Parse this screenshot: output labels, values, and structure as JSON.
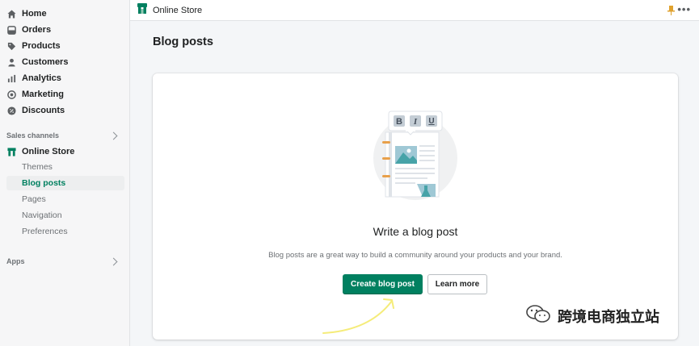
{
  "sidebar": {
    "items": [
      {
        "label": "Home",
        "icon": "home-icon"
      },
      {
        "label": "Orders",
        "icon": "orders-icon"
      },
      {
        "label": "Products",
        "icon": "tag-icon"
      },
      {
        "label": "Customers",
        "icon": "person-icon"
      },
      {
        "label": "Analytics",
        "icon": "bar-chart-icon"
      },
      {
        "label": "Marketing",
        "icon": "target-icon"
      },
      {
        "label": "Discounts",
        "icon": "discount-icon"
      }
    ],
    "sales_channels_label": "Sales channels",
    "online_store_label": "Online Store",
    "sub_items": [
      {
        "label": "Themes"
      },
      {
        "label": "Blog posts",
        "active": true
      },
      {
        "label": "Pages"
      },
      {
        "label": "Navigation"
      },
      {
        "label": "Preferences"
      }
    ],
    "apps_label": "Apps"
  },
  "topbar": {
    "title": "Online Store"
  },
  "main": {
    "page_title": "Blog posts",
    "empty_state": {
      "heading": "Write a blog post",
      "description": "Blog posts are a great way to build a community around your products and your brand.",
      "primary_button": "Create blog post",
      "secondary_button": "Learn more"
    }
  },
  "watermark": {
    "text": "跨境电商独立站"
  },
  "colors": {
    "accent": "#008060",
    "annotation_arrow": "#f5ec7a"
  }
}
